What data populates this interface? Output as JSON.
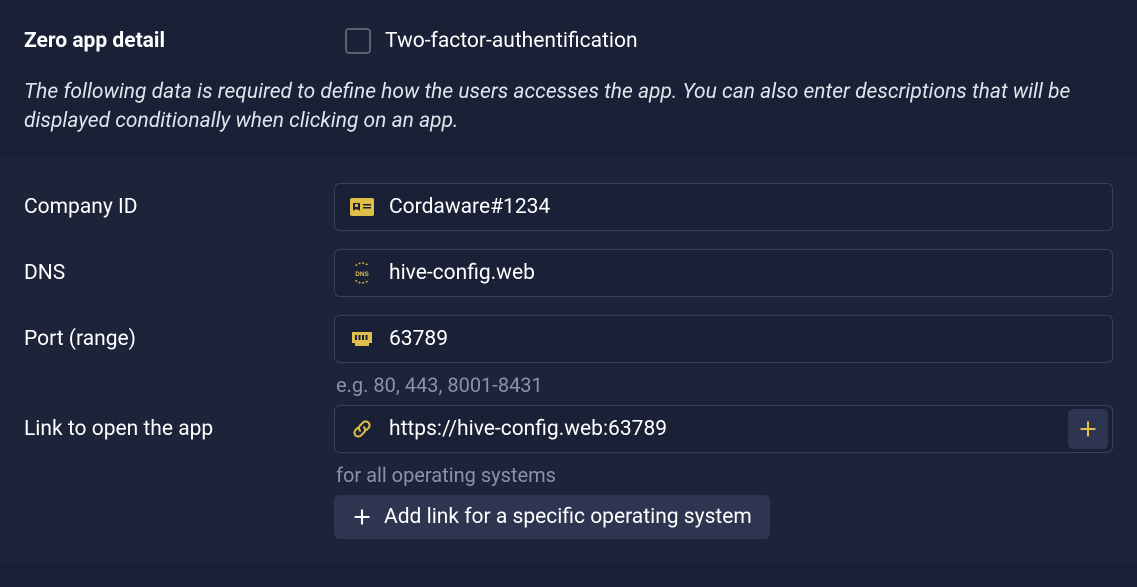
{
  "header": {
    "title": "Zero app detail",
    "twofa_label": "Two-factor-authentification",
    "description": "The following data is required to define how the users accesses the app. You can also enter descriptions that will be displayed conditionally when clicking on an app."
  },
  "form": {
    "company_id": {
      "label": "Company ID",
      "value": "Cordaware#1234"
    },
    "dns": {
      "label": "DNS",
      "value": "hive-config.web"
    },
    "port": {
      "label": "Port (range)",
      "value": "63789",
      "hint": "e.g. 80, 443, 8001-8431"
    },
    "link": {
      "label": "Link to open the app",
      "value": "https://hive-config.web:63789",
      "hint": "for all operating systems"
    },
    "add_os_button": "Add link for a specific operating system"
  }
}
